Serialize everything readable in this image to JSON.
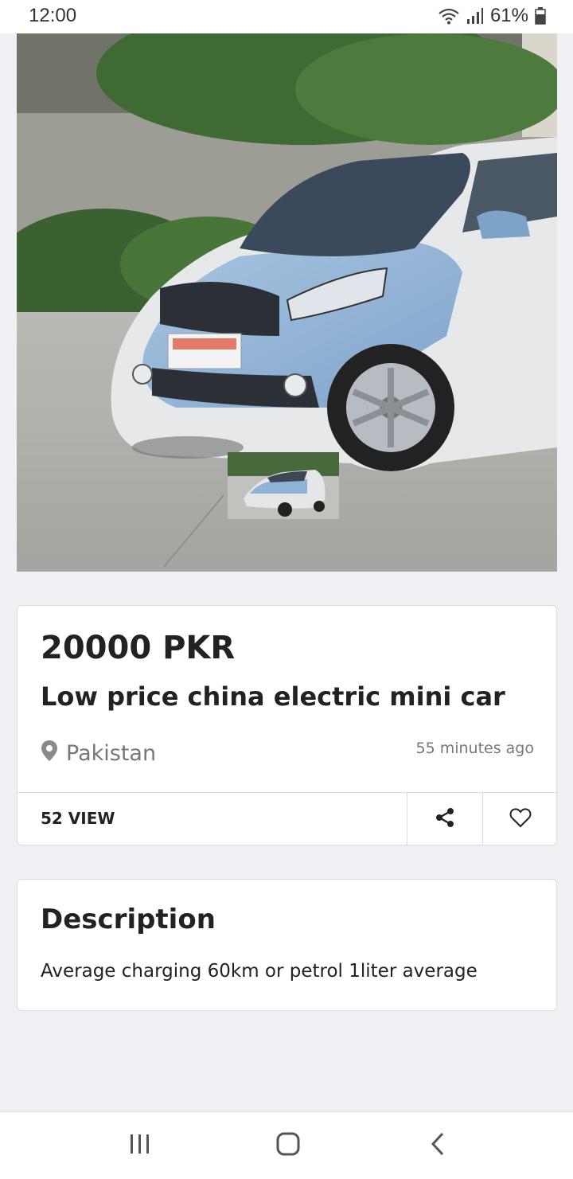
{
  "status_bar": {
    "time": "12:00",
    "battery": "61%",
    "icons": [
      "wifi-icon",
      "signal-icon",
      "battery-icon"
    ]
  },
  "listing": {
    "image_alt": "Blue and white electric mini car",
    "price": "20000 PKR",
    "title": "Low price china electric mini car",
    "location": "Pakistan",
    "posted": "55 minutes ago",
    "views": "52 VIEW",
    "location_icon": "map-pin-icon",
    "share_icon": "share-icon",
    "favorite_icon": "heart-icon"
  },
  "description": {
    "title": "Description",
    "text": "Average charging 60km or petrol 1liter average"
  },
  "nav": {
    "icons": [
      "recent-apps-icon",
      "home-icon",
      "back-icon"
    ]
  },
  "colors": {
    "background": "#eff0f4",
    "card": "#ffffff",
    "border": "#d9dbe0",
    "text": "#222222",
    "muted": "#777777",
    "car_blue": "#8fb3d6"
  }
}
